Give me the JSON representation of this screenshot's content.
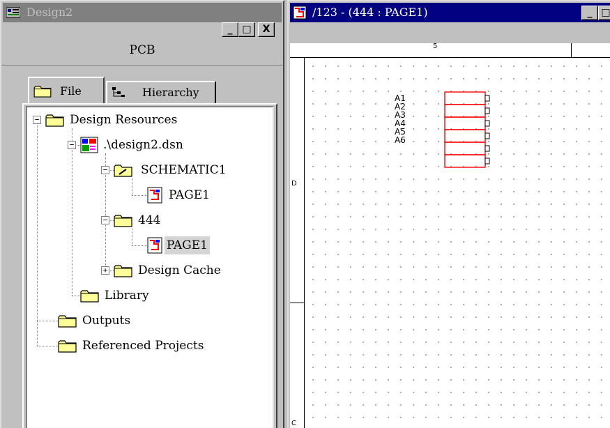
{
  "left_window": {
    "title": "Design2",
    "buttons": {
      "minimize": "_",
      "maximize": "□",
      "close": "X"
    },
    "header": "PCB",
    "tabs": [
      {
        "label": "File",
        "icon": "folder-icon",
        "active": true
      },
      {
        "label": "Hierarchy",
        "icon": "hierarchy-icon",
        "active": false
      }
    ],
    "tree": {
      "design_resources": "Design Resources",
      "dsn": ".\\design2.dsn",
      "schematic1": "SCHEMATIC1",
      "schematic1_page": "PAGE1",
      "folder_444": "444",
      "page_444": "PAGE1",
      "design_cache": "Design Cache",
      "library": "Library",
      "outputs": "Outputs",
      "referenced_projects": "Referenced Projects"
    }
  },
  "right_window": {
    "title": "/123 - (444 : PAGE1)",
    "ruler_top_label": "5",
    "border_labels": [
      "D",
      "C"
    ],
    "pins": [
      "A1",
      "A2",
      "A3",
      "A4",
      "A5",
      "A6"
    ],
    "colors": {
      "part_outline": "#ff0000",
      "grid_dot": "#a8a8a8",
      "title_active": "#000080"
    }
  }
}
